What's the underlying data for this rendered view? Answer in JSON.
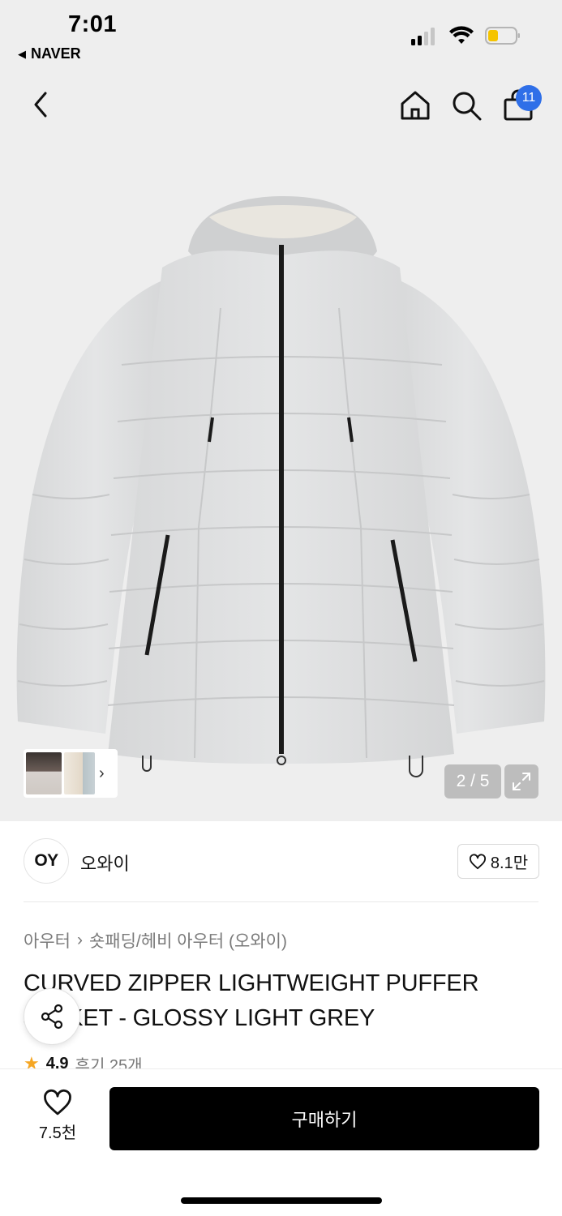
{
  "status_bar": {
    "time": "7:01",
    "back_app": "NAVER",
    "battery_color": "#f5c400"
  },
  "navbar": {
    "back_icon": "chevron-left-icon",
    "home_icon": "home-icon",
    "search_icon": "search-icon",
    "cart_icon": "shopping-bag-icon",
    "cart_badge": "11",
    "badge_color": "#2f6fe8"
  },
  "gallery": {
    "counter": "2 / 5",
    "current_index": 2,
    "total": 5,
    "thumb_arrow": "›",
    "expand_icon": "expand-icon"
  },
  "brand": {
    "logo_text": "OY",
    "name": "오와이",
    "like_count": "8.1만"
  },
  "product": {
    "breadcrumb": [
      "아우터",
      "숏패딩/헤비 아우터 (오와이)"
    ],
    "breadcrumb_sep": "›",
    "title": "CURVED ZIPPER LIGHTWEIGHT PUFFER JACKET - GLOSSY LIGHT GREY",
    "rating": "4.9",
    "review_label": "후기 25개"
  },
  "bottom_bar": {
    "wish_count": "7.5천",
    "buy_label": "구매하기",
    "buy_color": "#000000"
  }
}
